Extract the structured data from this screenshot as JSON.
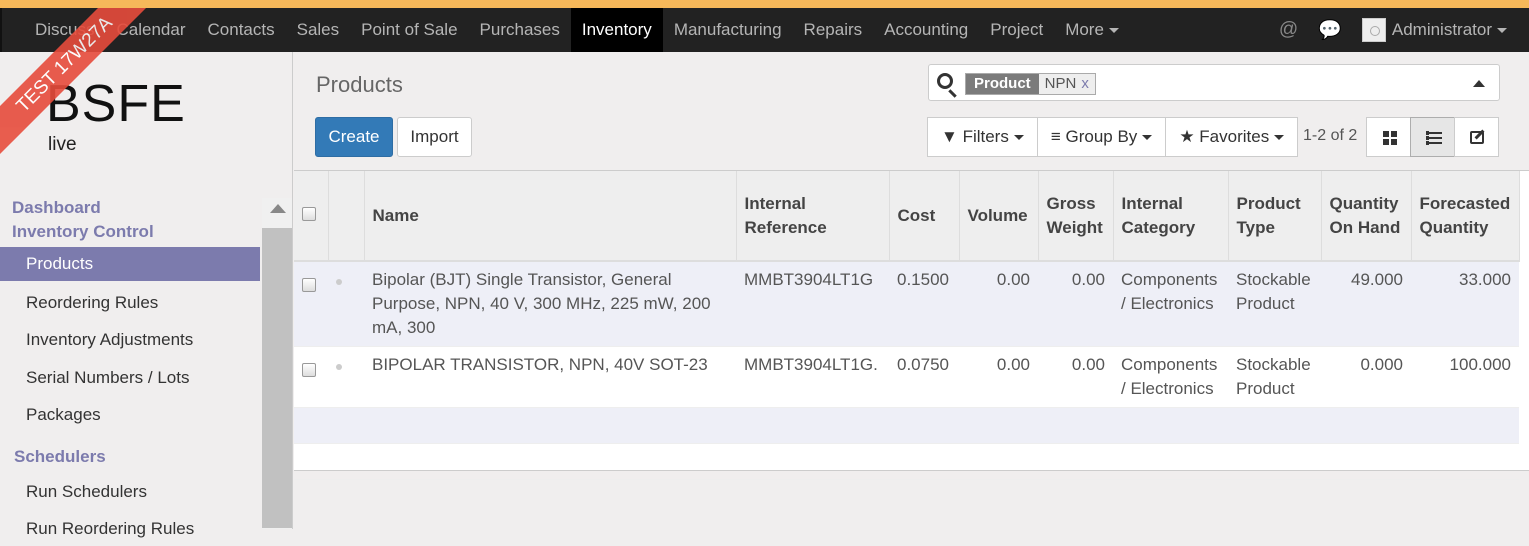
{
  "menu": {
    "items": [
      "Discuss",
      "Calendar",
      "Contacts",
      "Sales",
      "Point of Sale",
      "Purchases",
      "Inventory",
      "Manufacturing",
      "Repairs",
      "Accounting",
      "Project",
      "More"
    ],
    "active": "Inventory",
    "user": "Administrator",
    "icons": [
      "at-icon",
      "chat-icon"
    ]
  },
  "ribbon": "TEST 17W27A",
  "logo": {
    "name": "BSFE",
    "sub": "live"
  },
  "sidebar": {
    "sections": [
      {
        "title": "Dashboard\nInventory Control",
        "items": [
          "Products",
          "Reordering Rules",
          "Inventory Adjustments",
          "Serial Numbers / Lots",
          "Packages"
        ]
      },
      {
        "title": "Schedulers",
        "items": [
          "Run Schedulers",
          "Run Reordering Rules"
        ]
      }
    ],
    "active": "Products"
  },
  "main": {
    "title": "Products",
    "create_label": "Create",
    "import_label": "Import",
    "search": {
      "facet_label": "Product",
      "facet_value": "NPN",
      "facet_remove": "x"
    },
    "filters_label": "Filters",
    "groupby_label": "Group By",
    "favorites_label": "Favorites",
    "pager": "1-2 of 2"
  },
  "table": {
    "columns": [
      "Name",
      "Internal Reference",
      "Cost",
      "Volume",
      "Gross Weight",
      "Internal Category",
      "Product Type",
      "Quantity On Hand",
      "Forecasted Quantity"
    ],
    "rows": [
      [
        "Bipolar (BJT) Single Transistor, General Purpose, NPN, 40 V, 300 MHz, 225 mW, 200 mA, 300",
        "MMBT3904LT1G",
        "0.1500",
        "0.00",
        "0.00",
        "Components / Electronics",
        "Stockable Product",
        "49.000",
        "33.000"
      ],
      [
        "BIPOLAR TRANSISTOR, NPN, 40V SOT-23",
        "MMBT3904LT1G.",
        "0.0750",
        "0.00",
        "0.00",
        "Components / Electronics",
        "Stockable Product",
        "0.000",
        "100.000"
      ]
    ]
  }
}
